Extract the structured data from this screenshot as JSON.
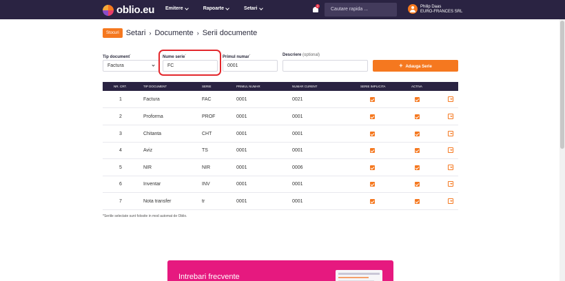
{
  "brand": {
    "logo_text": "oblio.eu"
  },
  "nav": [
    {
      "label": "Emitere"
    },
    {
      "label": "Rapoarte"
    },
    {
      "label": "Setari"
    }
  ],
  "notifications": {
    "badge": "2"
  },
  "search": {
    "placeholder": "Cautare rapida ..."
  },
  "user": {
    "name": "Philip Daas",
    "company": "EURO-FRANCES SRL"
  },
  "breadcrumb": {
    "button": "Stocuri",
    "items": [
      "Setari",
      "Documente",
      "Serii documente"
    ]
  },
  "form": {
    "tip_document": {
      "label": "Tip document",
      "value": "Factura"
    },
    "nume_serie": {
      "label": "Nume serie",
      "value": "FC"
    },
    "primul_numar": {
      "label": "Primul numar",
      "value": "0001"
    },
    "descriere": {
      "label": "Descriere",
      "optional": "(optional)",
      "value": ""
    },
    "add_button": "Adauga Serie"
  },
  "table": {
    "headers": [
      "NR. CRT.",
      "TIP DOCUMENT",
      "SERIE",
      "PRIMUL NUMAR",
      "NUMAR CURENT",
      "SERIE IMPLICITA",
      "ACTIVA"
    ],
    "rows": [
      {
        "nr": "1",
        "tip": "Factura",
        "serie": "FAC",
        "primul": "0001",
        "curent": "0021",
        "implicita": true,
        "activa": true
      },
      {
        "nr": "2",
        "tip": "Proforma",
        "serie": "PROF",
        "primul": "0001",
        "curent": "0001",
        "implicita": true,
        "activa": true
      },
      {
        "nr": "3",
        "tip": "Chitanta",
        "serie": "CHT",
        "primul": "0001",
        "curent": "0001",
        "implicita": true,
        "activa": true
      },
      {
        "nr": "4",
        "tip": "Aviz",
        "serie": "TS",
        "primul": "0001",
        "curent": "0001",
        "implicita": true,
        "activa": true
      },
      {
        "nr": "5",
        "tip": "NIR",
        "serie": "NIR",
        "primul": "0001",
        "curent": "0006",
        "implicita": true,
        "activa": true
      },
      {
        "nr": "6",
        "tip": "Inventar",
        "serie": "INV",
        "primul": "0001",
        "curent": "0001",
        "implicita": true,
        "activa": true
      },
      {
        "nr": "7",
        "tip": "Nota transfer",
        "serie": "tr",
        "primul": "0001",
        "curent": "0001",
        "implicita": true,
        "activa": true
      }
    ]
  },
  "footnote": "*Seriile selectate sunt folosite in mod automat de Oblio.",
  "faq": {
    "title": "Intrebari frecvente"
  },
  "colors": {
    "topbar": "#2a2342",
    "accent": "#f5781f",
    "highlight": "#e3262b",
    "faq": "#e6197f"
  }
}
